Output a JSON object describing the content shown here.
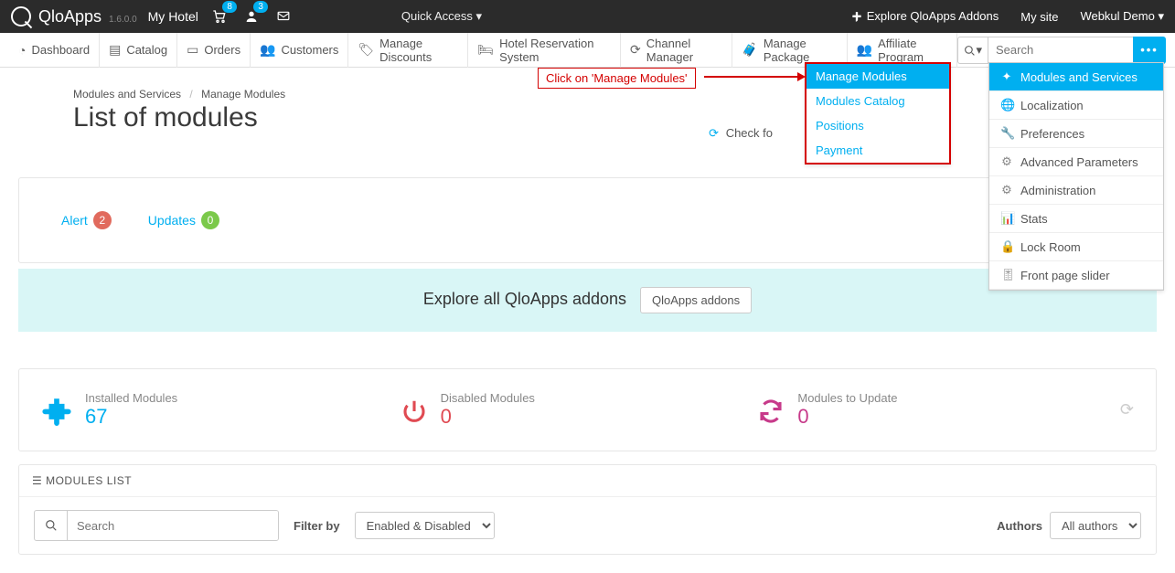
{
  "app": {
    "name": "QloApps",
    "version": "1.6.0.0",
    "hotel": "My Hotel"
  },
  "topbar": {
    "cart_badge": "8",
    "user_badge": "3",
    "quick_access": "Quick Access",
    "addons": "Explore QloApps Addons",
    "my_site": "My site",
    "user_menu": "Webkul Demo"
  },
  "mainnav": {
    "dashboard": "Dashboard",
    "catalog": "Catalog",
    "orders": "Orders",
    "customers": "Customers",
    "discounts": "Manage Discounts",
    "hotel_res": "Hotel Reservation System",
    "channel": "Channel Manager",
    "package": "Manage Package",
    "affiliate": "Affiliate Program",
    "search_placeholder": "Search"
  },
  "dropdown_modules": {
    "manage": "Manage Modules",
    "catalog": "Modules Catalog",
    "positions": "Positions",
    "payment": "Payment"
  },
  "dropdown_more": {
    "modules": "Modules and Services",
    "localization": "Localization",
    "preferences": "Preferences",
    "advanced": "Advanced Parameters",
    "administration": "Administration",
    "stats": "Stats",
    "lock": "Lock Room",
    "front": "Front page slider"
  },
  "callout": "Click on 'Manage Modules'",
  "breadcrumb": {
    "a": "Modules and Services",
    "b": "Manage Modules"
  },
  "page_title": "List of modules",
  "check_update": "Check fo",
  "alerts": {
    "alert_label": "Alert",
    "alert_count": "2",
    "updates_label": "Updates",
    "updates_count": "0"
  },
  "explore": {
    "text": "Explore all QloApps addons",
    "btn": "QloApps addons"
  },
  "stats": {
    "installed_label": "Installed Modules",
    "installed_val": "67",
    "disabled_label": "Disabled Modules",
    "disabled_val": "0",
    "update_label": "Modules to Update",
    "update_val": "0"
  },
  "modules_list": {
    "heading": "MODULES LIST",
    "search_placeholder": "Search",
    "filter_label": "Filter by",
    "filter_value": "Enabled & Disabled",
    "authors_label": "Authors",
    "authors_value": "All authors"
  }
}
